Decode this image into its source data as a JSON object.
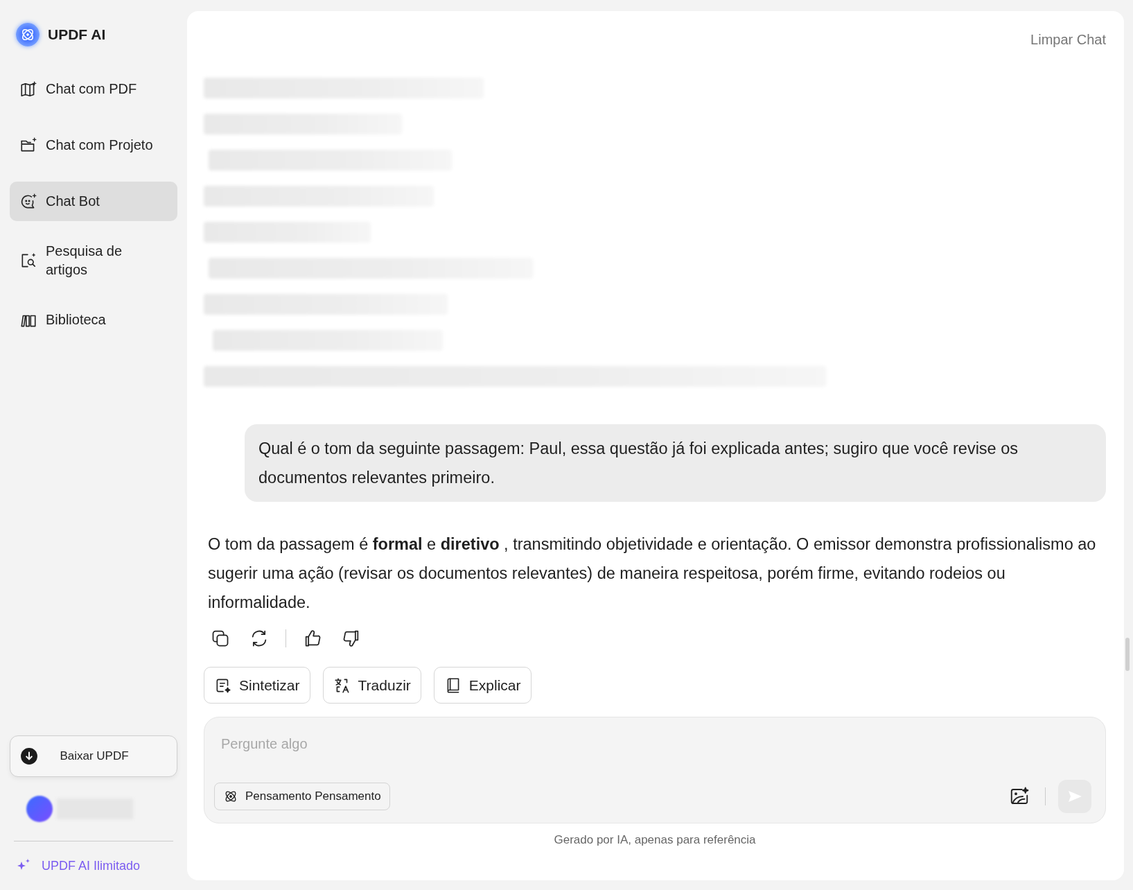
{
  "app": {
    "name": "UPDF AI"
  },
  "nav": [
    {
      "label": "Chat com PDF",
      "kind": "pdf",
      "selected": false
    },
    {
      "label": "Chat com Projeto",
      "kind": "project",
      "selected": false
    },
    {
      "label": "Chat Bot",
      "kind": "bot",
      "selected": true
    },
    {
      "label": "Pesquisa de artigos",
      "kind": "research",
      "selected": false
    },
    {
      "label": "Biblioteca",
      "kind": "library",
      "selected": false
    }
  ],
  "download_button": "Baixar UPDF",
  "upgrade_link": "UPDF AI Ilimitado",
  "header": {
    "clear_button": "Limpar Chat"
  },
  "user_message": {
    "text": "Qual é o tom da seguinte passagem: Paul, essa questão já foi explicada antes; sugiro que você revise os documentos relevantes primeiro."
  },
  "assistant_message": {
    "text": "O tom da passagem é **formal** e **diretivo** , transmitindo objetividade e orientação. O emissor demonstra profissionalismo ao sugerir uma ação (revisar os documentos relevantes) de maneira respeitosa, porém firme, evitando rodeios ou informalidade."
  },
  "quick_actions": [
    {
      "label": "Sintetizar",
      "kind": "summarize"
    },
    {
      "label": "Traduzir",
      "kind": "translate"
    },
    {
      "label": "Explicar",
      "kind": "explain"
    }
  ],
  "input": {
    "placeholder": "Pergunte algo"
  },
  "mode_button": "Pensamento Pensamento",
  "footer_note": "Gerado por IA, apenas para referência"
}
